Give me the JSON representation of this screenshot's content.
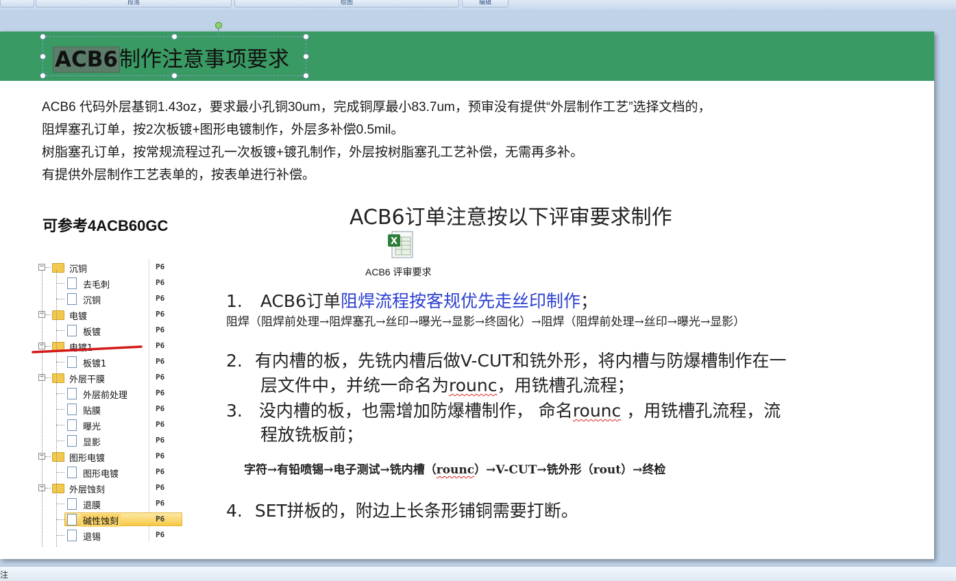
{
  "ribbon": {
    "groups": [
      "",
      "段落",
      "绘图",
      "编辑"
    ]
  },
  "slide": {
    "title_prefix": "ACB6",
    "title_rest": "制作注意事项要求",
    "paragraphs": [
      "ACB6 代码外层基铜1.43oz，要求最小孔铜30um，完成铜厚最小83.7um，预审没有提供“外层制作工艺”选择文档的，",
      "阻焊塞孔订单，按2次板镀+图形电镀制作，外层多补偿0.5mil。",
      "树脂塞孔订单，按常规流程过孔一次板镀+镀孔制作，外层按树脂塞孔工艺补偿，无需再多补。",
      "有提供外层制作工艺表单的，按表单进行补偿。"
    ],
    "ref_heading": "可参考4ACB60GC",
    "tree": [
      {
        "label": "沉铜",
        "code": "P6",
        "type": "folder",
        "level": 0
      },
      {
        "label": "去毛刺",
        "code": "P6",
        "type": "doc",
        "level": 1
      },
      {
        "label": "沉铜",
        "code": "P6",
        "type": "doc",
        "level": 1
      },
      {
        "label": "电镀",
        "code": "P6",
        "type": "folder",
        "level": 0
      },
      {
        "label": "板镀",
        "code": "P6",
        "type": "doc",
        "level": 1
      },
      {
        "label": "电镀1",
        "code": "P6",
        "type": "folder",
        "level": 0
      },
      {
        "label": "板镀1",
        "code": "P6",
        "type": "doc",
        "level": 1
      },
      {
        "label": "外层干膜",
        "code": "P6",
        "type": "folder",
        "level": 0
      },
      {
        "label": "外层前处理",
        "code": "P6",
        "type": "doc",
        "level": 1
      },
      {
        "label": "贴膜",
        "code": "P6",
        "type": "doc",
        "level": 1
      },
      {
        "label": "曝光",
        "code": "P6",
        "type": "doc",
        "level": 1
      },
      {
        "label": "显影",
        "code": "P6",
        "type": "doc",
        "level": 1
      },
      {
        "label": "图形电镀",
        "code": "P6",
        "type": "folder",
        "level": 0
      },
      {
        "label": "图形电镀",
        "code": "P6",
        "type": "doc",
        "level": 1
      },
      {
        "label": "外层蚀刻",
        "code": "P6",
        "type": "folder",
        "level": 0
      },
      {
        "label": "退膜",
        "code": "P6",
        "type": "doc",
        "level": 1
      },
      {
        "label": "碱性蚀刻",
        "code": "P6",
        "type": "doc",
        "level": 1,
        "selected": true
      },
      {
        "label": "退锡",
        "code": "P6",
        "type": "doc",
        "level": 1
      }
    ],
    "right_heading": "ACB6订单注意按以下评审要求制作",
    "attachment_caption": "ACB6 评审要求",
    "item1": {
      "num": "1.",
      "prefix": "ACB6订单",
      "highlight": "阻焊流程按客规优先走丝印制作",
      "suffix": "；"
    },
    "item1_flow": "阻焊（阻焊前处理→阻焊塞孔→丝印→曝光→显影→终固化）→阻焊（阻焊前处理→丝印→曝光→显影）",
    "item2": {
      "num": "2.",
      "line1": "有内槽的板，先铣内槽后做V-CUT和铣外形，将内槽与防爆槽制作在一",
      "line2_a": "层文件中，并统一命名为",
      "line2_b": "rounc",
      "line2_c": "，用铣槽孔流程；"
    },
    "item3": {
      "num": "3.",
      "line1_a": "没内槽的板，也需增加防爆槽制作， 命名",
      "line1_b": "rounc",
      "line1_c": " ，用铣槽孔流程，流",
      "line2": "程放铣板前；"
    },
    "item3_flow_a": "字符→有铅喷锡→电子测试→铣内槽（",
    "item3_flow_b": "rounc",
    "item3_flow_c": "）→V-CUT→铣外形（rout）→终检",
    "item4": {
      "num": "4.",
      "text": "SET拼板的，附边上长条形铺铜需要打断。"
    }
  },
  "status_bar": {
    "text": "注"
  },
  "colors": {
    "banner": "#3a9a63",
    "highlight_blue": "#2a3fd0",
    "red_mark": "#d41a1a"
  }
}
